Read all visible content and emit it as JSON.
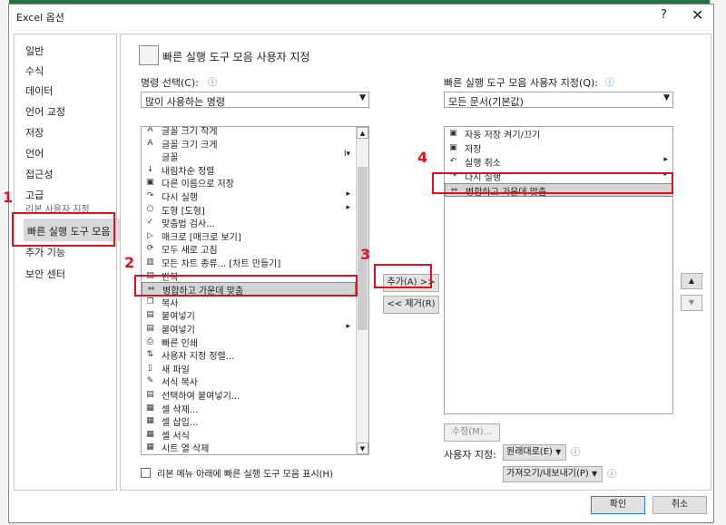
{
  "dialog": {
    "title": "Excel 옵션",
    "help": "?",
    "close": "✕"
  },
  "nav": [
    {
      "label": "일반"
    },
    {
      "label": "수식"
    },
    {
      "label": "데이터"
    },
    {
      "label": "언어 교정"
    },
    {
      "label": "저장"
    },
    {
      "label": "언어"
    },
    {
      "label": "접근성"
    },
    {
      "label": "고급"
    },
    {
      "label": "리본 사용자 지정"
    },
    {
      "label": "빠른 실행 도구 모음"
    },
    {
      "label": "추가 기능"
    },
    {
      "label": "보안 센터"
    }
  ],
  "main": {
    "heading": "빠른 실행 도구 모음 사용자 지정",
    "commands_label": "명령 선택(C):",
    "commands_value": "많이 사용하는 명령",
    "customize_label": "빠른 실행 도구 모음 사용자 지정(Q):",
    "customize_value": "모든 문서(기본값)",
    "commands": [
      {
        "icon": "font-size-down-icon",
        "glyph": "A",
        "label": "글꼴 크기 작게",
        "sub": ""
      },
      {
        "icon": "font-size-up-icon",
        "glyph": "A",
        "label": "글꼴 크기 크게",
        "sub": ""
      },
      {
        "icon": "font-icon",
        "glyph": "",
        "label": "글꼴",
        "sub": "I▾"
      },
      {
        "icon": "sort-desc-icon",
        "glyph": "↓",
        "label": "내림차순 정렬",
        "sub": ""
      },
      {
        "icon": "save-as-icon",
        "glyph": "▣",
        "label": "다른 이름으로 저장",
        "sub": ""
      },
      {
        "icon": "redo-icon",
        "glyph": "↷",
        "label": "다시 실행",
        "sub": "▸"
      },
      {
        "icon": "shape-icon",
        "glyph": "⬠",
        "label": "도형 [도형]",
        "sub": "▸"
      },
      {
        "icon": "spellcheck-icon",
        "glyph": "✓",
        "label": "맞춤법 검사...",
        "sub": ""
      },
      {
        "icon": "macro-icon",
        "glyph": "▷",
        "label": "매크로 [매크로 보기]",
        "sub": ""
      },
      {
        "icon": "refresh-all-icon",
        "glyph": "⟳",
        "label": "모두 새로 고침",
        "sub": ""
      },
      {
        "icon": "all-charts-icon",
        "glyph": "▥",
        "label": "모든 차트 종류... [차트 만들기]",
        "sub": ""
      },
      {
        "icon": "paste-icon",
        "glyph": "▤",
        "label": "반복",
        "sub": ""
      },
      {
        "icon": "merge-center-icon",
        "glyph": "⇔",
        "label": "병합하고 가운데 맞춤",
        "sub": ""
      },
      {
        "icon": "copy-icon",
        "glyph": "❐",
        "label": "복사",
        "sub": ""
      },
      {
        "icon": "paste-icon",
        "glyph": "▤",
        "label": "붙여넣기",
        "sub": ""
      },
      {
        "icon": "paste-options-icon",
        "glyph": "▤",
        "label": "붙여넣기",
        "sub": "▸"
      },
      {
        "icon": "print-icon",
        "glyph": "⎙",
        "label": "빠른 인쇄",
        "sub": ""
      },
      {
        "icon": "custom-sort-icon",
        "glyph": "⇅",
        "label": "사용자 지정 정렬...",
        "sub": ""
      },
      {
        "icon": "new-file-icon",
        "glyph": "▯",
        "label": "새 파일",
        "sub": ""
      },
      {
        "icon": "format-painter-icon",
        "glyph": "✎",
        "label": "서식 복사",
        "sub": ""
      },
      {
        "icon": "paste-special-icon",
        "glyph": "▤",
        "label": "선택하여 붙여넣기...",
        "sub": ""
      },
      {
        "icon": "delete-cells-icon",
        "glyph": "▦",
        "label": "셀 삭제...",
        "sub": ""
      },
      {
        "icon": "insert-cells-icon",
        "glyph": "▦",
        "label": "셀 삽입...",
        "sub": ""
      },
      {
        "icon": "format-cells-icon",
        "glyph": "▦",
        "label": "셀 서식",
        "sub": ""
      },
      {
        "icon": "delete-sheet-column-icon",
        "glyph": "▦",
        "label": "시트 열 삭제",
        "sub": ""
      }
    ],
    "toolbar_items": [
      {
        "icon": "autosave-icon",
        "glyph": "▣",
        "label": "자동 저장 켜기/끄기",
        "sub": ""
      },
      {
        "icon": "save-icon",
        "glyph": "▣",
        "label": "저장",
        "sub": ""
      },
      {
        "icon": "undo-icon",
        "glyph": "↶",
        "label": "실행 취소",
        "sub": "▸"
      },
      {
        "icon": "redo-icon",
        "glyph": "↷",
        "label": "다시 실행",
        "sub": "▸"
      },
      {
        "icon": "merge-center-icon",
        "glyph": "⇔",
        "label": "병합하고 가운데 맞춤",
        "sub": ""
      }
    ],
    "add_button": "추가(A) >>",
    "remove_button": "<< 제거(R)",
    "modify_button": "수정(M)...",
    "customizations_label": "사용자 지정:",
    "reset_button": "원래대로(E)",
    "import_export_button": "가져오기/내보내기(P)",
    "show_below_label": "리본 메뉴 아래에 빠른 실행 도구 모음 표시(H)",
    "move_up": "▲",
    "move_down": "▼"
  },
  "footer": {
    "ok": "확인",
    "cancel": "취소"
  },
  "annotations": {
    "n1": "1",
    "n2": "2",
    "n3": "3",
    "n4": "4"
  },
  "colors": {
    "annotation_red": "#e0101e",
    "excel_green": "#217346",
    "selection_gray": "#d4d4d4"
  }
}
